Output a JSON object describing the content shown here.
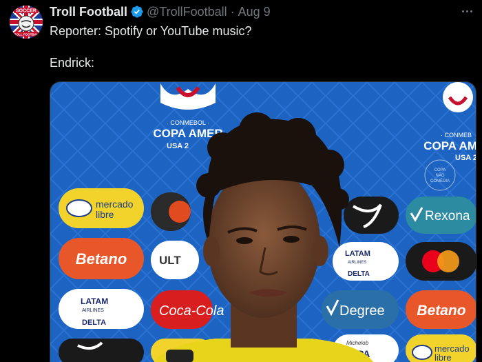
{
  "tweet": {
    "author_name": "Troll Football",
    "handle": "@TrollFootball",
    "separator": "·",
    "date": "Aug 9",
    "line1": "Reporter: Spotify or YouTube music?",
    "line2": "Endrick:"
  },
  "avatar": {
    "top_text": "SOCCER",
    "bottom_text": "TROLL FOOTBALL"
  },
  "media": {
    "conmebol": "· CONMEBOL ·",
    "copa_left": "COPA AMER",
    "usa_left": "USA 2",
    "copa_right": "COPA AM",
    "usa_right": "USA 2",
    "conmebol_right": "· CONMEB",
    "watermark_a": "COPA",
    "watermark_b": "NÃO",
    "watermark_c": "COMÉDIA",
    "mercado_a": "mercado",
    "mercado_b": "libre",
    "rexona": "Rexona",
    "betano": "Betano",
    "latam": "LATAM",
    "airlines": "AIRLINES",
    "delta": "DELTA",
    "degree": "Degree",
    "coca": "Coca-Cola",
    "ult": "ULT",
    "michelob": "Michelob"
  },
  "colors": {
    "background": "#000000",
    "text": "#e7e9ea",
    "muted": "#71767b",
    "verified": "#1d9bf0",
    "backdrop_blue": "#1a5fb4"
  }
}
